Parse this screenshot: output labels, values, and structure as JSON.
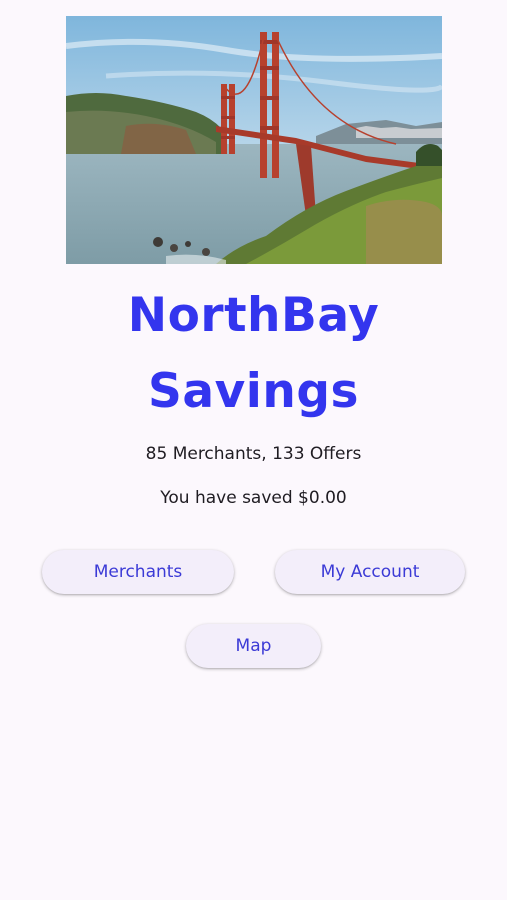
{
  "hero": {
    "image": "golden-gate-bridge-photo"
  },
  "title": {
    "line1": "NorthBay",
    "line2": "Savings",
    "color": "#3335ee"
  },
  "stats": {
    "summary": "85 Merchants, 133 Offers",
    "saved": "You have saved $0.00"
  },
  "buttons": {
    "merchants": "Merchants",
    "my_account": "My Account",
    "map": "Map"
  },
  "colors": {
    "background": "#fcf8fd",
    "button_bg": "#f3eefa",
    "button_text": "#3b3ad6"
  }
}
